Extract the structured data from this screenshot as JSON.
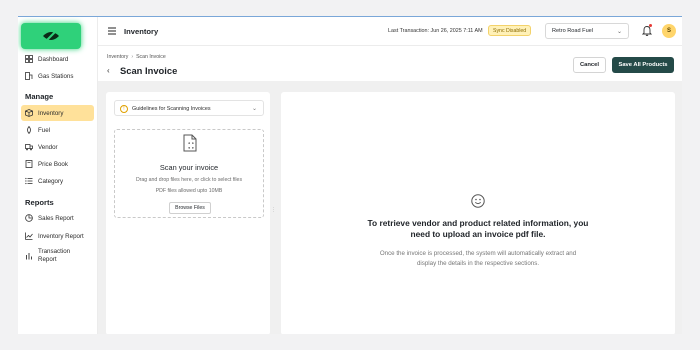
{
  "sidebar": {
    "items": [
      {
        "label": "Dashboard",
        "icon": "dashboard-icon"
      },
      {
        "label": "Gas Stations",
        "icon": "gas-station-icon"
      }
    ],
    "manage_title": "Manage",
    "manage_items": [
      {
        "label": "Inventory",
        "icon": "box-icon",
        "active": true
      },
      {
        "label": "Fuel",
        "icon": "fuel-icon"
      },
      {
        "label": "Vendor",
        "icon": "truck-icon"
      },
      {
        "label": "Price Book",
        "icon": "book-icon"
      },
      {
        "label": "Category",
        "icon": "list-icon"
      }
    ],
    "reports_title": "Reports",
    "report_items": [
      {
        "label": "Sales Report",
        "icon": "chart-pie-icon"
      },
      {
        "label": "Inventory Report",
        "icon": "trend-icon"
      },
      {
        "label": "Transaction Report",
        "icon": "bar-chart-icon"
      }
    ]
  },
  "header": {
    "title": "Inventory",
    "last_transaction": "Last Transaction: Jun 26, 2025 7:11 AM",
    "sync_status": "Sync Disabled",
    "store": "Retro Road Fuel",
    "avatar_initial": "S"
  },
  "breadcrumb": {
    "parent": "Inventory",
    "current": "Scan Invoice"
  },
  "page": {
    "title": "Scan Invoice",
    "cancel_label": "Cancel",
    "save_label": "Save All Products"
  },
  "guidelines": {
    "label": "Guidelines for Scanning Invoices"
  },
  "dropzone": {
    "title": "Scan your invoice",
    "line1": "Drag and drop files here, or click to select files",
    "line2": "PDF files allowed upto 10MB",
    "browse_label": "Browse Files"
  },
  "empty_state": {
    "title_line1": "To retrieve vendor and product related information, you",
    "title_line2": "need to upload an invoice pdf file.",
    "sub_line1": "Once the invoice is processed, the system will automatically extract and",
    "sub_line2": "display the details in the respective sections."
  },
  "colors": {
    "brand_green": "#2fd17a",
    "active_nav": "#ffe19a",
    "save_button": "#244a48",
    "sync_badge": "#fff1b8"
  }
}
